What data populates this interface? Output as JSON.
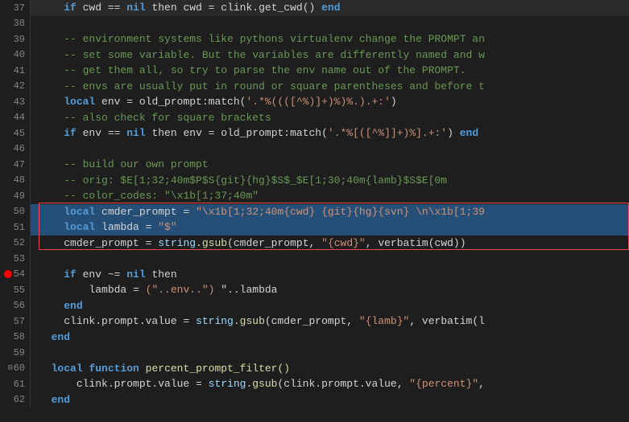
{
  "editor": {
    "lines": [
      {
        "num": 37,
        "tokens": [
          {
            "t": "    ",
            "c": "plain"
          },
          {
            "t": "if",
            "c": "kw"
          },
          {
            "t": " cwd == ",
            "c": "plain"
          },
          {
            "t": "nil",
            "c": "kw"
          },
          {
            "t": " then",
            "c": "plain"
          },
          {
            "t": " cwd = clink.get_cwd() ",
            "c": "plain"
          },
          {
            "t": "end",
            "c": "kw"
          }
        ],
        "highlight": false,
        "debugDot": false,
        "collapse": false
      },
      {
        "num": 38,
        "tokens": [],
        "highlight": false,
        "debugDot": false,
        "collapse": false
      },
      {
        "num": 39,
        "tokens": [
          {
            "t": "    ",
            "c": "plain"
          },
          {
            "t": "-- environment systems like pythons virtualenv change the PROMPT an",
            "c": "comment"
          }
        ],
        "highlight": false,
        "debugDot": false,
        "collapse": false
      },
      {
        "num": 40,
        "tokens": [
          {
            "t": "    ",
            "c": "plain"
          },
          {
            "t": "-- set some variable. But the variables are differently named and w",
            "c": "comment"
          }
        ],
        "highlight": false,
        "debugDot": false,
        "collapse": false
      },
      {
        "num": 41,
        "tokens": [
          {
            "t": "    ",
            "c": "plain"
          },
          {
            "t": "-- get them all, so try to parse the env name out of the PROMPT.",
            "c": "comment"
          }
        ],
        "highlight": false,
        "debugDot": false,
        "collapse": false
      },
      {
        "num": 42,
        "tokens": [
          {
            "t": "    ",
            "c": "plain"
          },
          {
            "t": "-- envs are usually put in round or square parentheses and before t",
            "c": "comment"
          }
        ],
        "highlight": false,
        "debugDot": false,
        "collapse": false
      },
      {
        "num": 43,
        "tokens": [
          {
            "t": "    ",
            "c": "plain"
          },
          {
            "t": "local",
            "c": "kw"
          },
          {
            "t": " env = old_prompt:match(",
            "c": "plain"
          },
          {
            "t": "'.*%((([^%)]+)%)%.).+:'",
            "c": "str"
          },
          {
            "t": ")",
            "c": "plain"
          }
        ],
        "highlight": false,
        "debugDot": false,
        "collapse": false
      },
      {
        "num": 44,
        "tokens": [
          {
            "t": "    ",
            "c": "plain"
          },
          {
            "t": "-- also check for square brackets",
            "c": "comment"
          }
        ],
        "highlight": false,
        "debugDot": false,
        "collapse": false
      },
      {
        "num": 45,
        "tokens": [
          {
            "t": "    ",
            "c": "plain"
          },
          {
            "t": "if",
            "c": "kw"
          },
          {
            "t": " env == ",
            "c": "plain"
          },
          {
            "t": "nil",
            "c": "kw"
          },
          {
            "t": " then",
            "c": "plain"
          },
          {
            "t": " env = old_prompt:match(",
            "c": "plain"
          },
          {
            "t": "'.*%[([^%]]+)%].+:'",
            "c": "str"
          },
          {
            "t": ") ",
            "c": "plain"
          },
          {
            "t": "end",
            "c": "kw"
          }
        ],
        "highlight": false,
        "debugDot": false,
        "collapse": false
      },
      {
        "num": 46,
        "tokens": [],
        "highlight": false,
        "debugDot": false,
        "collapse": false
      },
      {
        "num": 47,
        "tokens": [
          {
            "t": "    ",
            "c": "plain"
          },
          {
            "t": "-- build our own prompt",
            "c": "comment"
          }
        ],
        "highlight": false,
        "debugDot": false,
        "collapse": false
      },
      {
        "num": 48,
        "tokens": [
          {
            "t": "    ",
            "c": "plain"
          },
          {
            "t": "-- orig: $E[1;32;40m$P$S{git}{hg}$S$_$E[1;30;40m{lamb}$S$E[0m",
            "c": "comment"
          }
        ],
        "highlight": false,
        "debugDot": false,
        "collapse": false
      },
      {
        "num": 49,
        "tokens": [
          {
            "t": "    ",
            "c": "plain"
          },
          {
            "t": "-- color_codes: \"\\x1b[1;37;40m\"",
            "c": "comment"
          }
        ],
        "highlight": false,
        "debugDot": false,
        "collapse": false
      },
      {
        "num": 50,
        "tokens": [
          {
            "t": "    ",
            "c": "plain"
          },
          {
            "t": "local",
            "c": "kw"
          },
          {
            "t": " cmder_prompt = ",
            "c": "plain"
          },
          {
            "t": "\"\\x1b[1;32;40m{cwd} {git}{hg}{svn} \\n\\x1b[1;39",
            "c": "str"
          }
        ],
        "highlight": true,
        "debugDot": false,
        "collapse": false,
        "redBoxStart": true
      },
      {
        "num": 51,
        "tokens": [
          {
            "t": "    ",
            "c": "plain"
          },
          {
            "t": "local",
            "c": "kw"
          },
          {
            "t": " lambda = ",
            "c": "plain"
          },
          {
            "t": "\"$\"",
            "c": "str"
          }
        ],
        "highlight": true,
        "debugDot": false,
        "collapse": false
      },
      {
        "num": 52,
        "tokens": [
          {
            "t": "    ",
            "c": "plain"
          },
          {
            "t": "cmder_prompt = ",
            "c": "plain"
          },
          {
            "t": "string",
            "c": "var"
          },
          {
            "t": ".gsub",
            "c": "fn"
          },
          {
            "t": "(cmder_prompt, ",
            "c": "plain"
          },
          {
            "t": "\"{cwd}\"",
            "c": "str"
          },
          {
            "t": ", verbatim(cwd))",
            "c": "plain"
          }
        ],
        "highlight": false,
        "debugDot": false,
        "collapse": false,
        "redBoxEnd": true
      },
      {
        "num": 53,
        "tokens": [],
        "highlight": false,
        "debugDot": false,
        "collapse": false
      },
      {
        "num": 54,
        "tokens": [
          {
            "t": "    ",
            "c": "plain"
          },
          {
            "t": "if",
            "c": "kw"
          },
          {
            "t": " env ~= ",
            "c": "plain"
          },
          {
            "t": "nil",
            "c": "kw"
          },
          {
            "t": " then",
            "c": "plain"
          }
        ],
        "highlight": false,
        "debugDot": true,
        "collapse": false
      },
      {
        "num": 55,
        "tokens": [
          {
            "t": "        ",
            "c": "plain"
          },
          {
            "t": "lambda = ",
            "c": "plain"
          },
          {
            "t": "(\"..env..\")",
            "c": "str"
          },
          {
            "t": " \"..lambda",
            "c": "plain"
          }
        ],
        "highlight": false,
        "debugDot": false,
        "collapse": false
      },
      {
        "num": 56,
        "tokens": [
          {
            "t": "    ",
            "c": "plain"
          },
          {
            "t": "end",
            "c": "kw"
          }
        ],
        "highlight": false,
        "debugDot": false,
        "collapse": false
      },
      {
        "num": 57,
        "tokens": [
          {
            "t": "    ",
            "c": "plain"
          },
          {
            "t": "clink.prompt.value = ",
            "c": "plain"
          },
          {
            "t": "string",
            "c": "var"
          },
          {
            "t": ".gsub",
            "c": "fn"
          },
          {
            "t": "(cmder_prompt, ",
            "c": "plain"
          },
          {
            "t": "\"{lamb}\"",
            "c": "str"
          },
          {
            "t": ", verbatim(l",
            "c": "plain"
          }
        ],
        "highlight": false,
        "debugDot": false,
        "collapse": false
      },
      {
        "num": 58,
        "tokens": [
          {
            "t": "  ",
            "c": "plain"
          },
          {
            "t": "end",
            "c": "kw"
          }
        ],
        "highlight": false,
        "debugDot": false,
        "collapse": false
      },
      {
        "num": 59,
        "tokens": [],
        "highlight": false,
        "debugDot": false,
        "collapse": false
      },
      {
        "num": 60,
        "tokens": [
          {
            "t": "  ",
            "c": "plain"
          },
          {
            "t": "local",
            "c": "kw"
          },
          {
            "t": " ",
            "c": "plain"
          },
          {
            "t": "function",
            "c": "kw"
          },
          {
            "t": " percent_prompt_filter()",
            "c": "fn"
          }
        ],
        "highlight": false,
        "debugDot": false,
        "collapse": true
      },
      {
        "num": 61,
        "tokens": [
          {
            "t": "      ",
            "c": "plain"
          },
          {
            "t": "clink.prompt.value = ",
            "c": "plain"
          },
          {
            "t": "string",
            "c": "var"
          },
          {
            "t": ".gsub",
            "c": "fn"
          },
          {
            "t": "(clink.prompt.value, ",
            "c": "plain"
          },
          {
            "t": "\"{percent}\"",
            "c": "str"
          },
          {
            "t": ",",
            "c": "plain"
          }
        ],
        "highlight": false,
        "debugDot": false,
        "collapse": false
      },
      {
        "num": 62,
        "tokens": [
          {
            "t": "  ",
            "c": "plain"
          },
          {
            "t": "end",
            "c": "kw"
          }
        ],
        "highlight": false,
        "debugDot": false,
        "collapse": false
      }
    ]
  }
}
